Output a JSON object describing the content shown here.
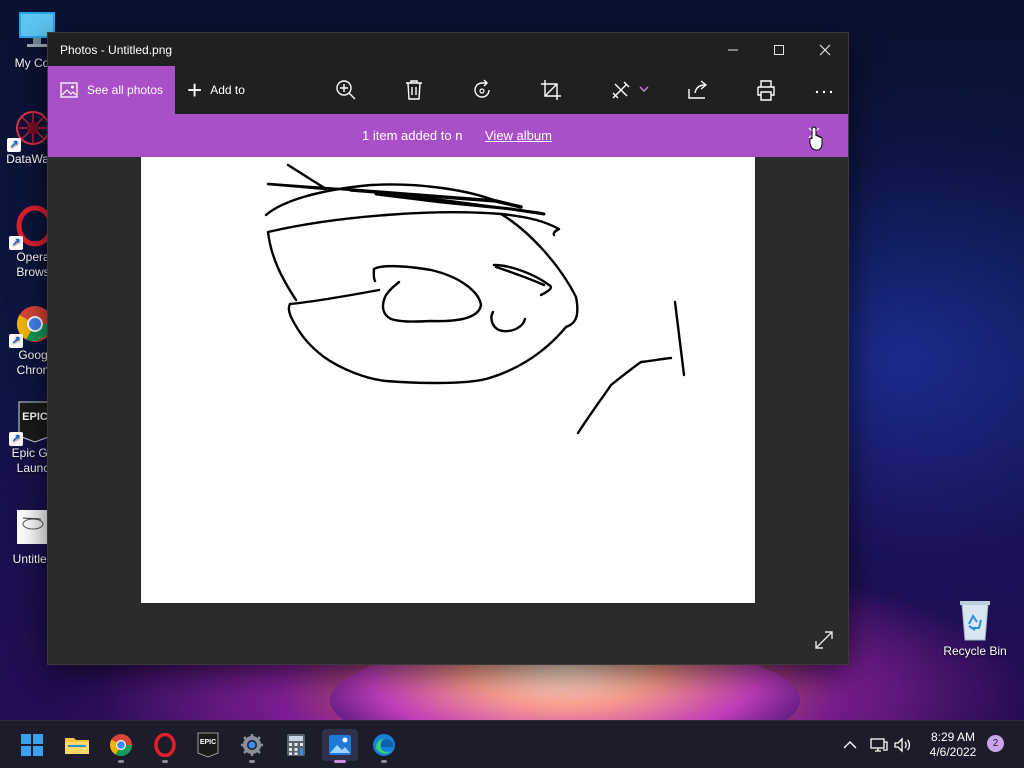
{
  "desktop": {
    "icons": [
      {
        "label": "My Com",
        "icon": "computer-icon"
      },
      {
        "label": "DataWag",
        "icon": "datawagon-icon"
      },
      {
        "label": "Opera\nBrows",
        "icon": "opera-icon"
      },
      {
        "label": "Goog\nChron",
        "icon": "chrome-icon"
      },
      {
        "label": "Epic Ga\nLaunc",
        "icon": "epic-games-icon",
        "badge_text": "EPIC"
      },
      {
        "label": "Untitled",
        "icon": "image-file-icon"
      }
    ],
    "recycle_bin": {
      "label": "Recycle Bin",
      "icon": "recycle-bin-icon"
    }
  },
  "window": {
    "title": "Photos - Untitled.png",
    "controls": {
      "minimize": "minimize-icon",
      "maximize": "maximize-icon",
      "close": "close-icon"
    },
    "toolbar": {
      "see_all_label": "See all photos",
      "add_to_label": "Add to",
      "tools": [
        "zoom-in-icon",
        "delete-icon",
        "rotate-icon",
        "crop-icon",
        "edit-draw-icon",
        "share-icon",
        "print-icon",
        "more-icon"
      ]
    },
    "notification": {
      "message": "1 item added to n",
      "link": "View album"
    }
  },
  "taskbar": {
    "apps": [
      "start-icon",
      "file-explorer-icon",
      "chrome-icon",
      "opera-icon",
      "epic-games-icon",
      "settings-icon",
      "calculator-icon",
      "photos-icon",
      "edge-icon"
    ],
    "epic_text": "EPIC",
    "active_app": "photos-icon",
    "clock": {
      "time": "8:29 AM",
      "date": "4/6/2022"
    },
    "notification_count": "2"
  },
  "colors": {
    "accent": "#a94fc7",
    "titlebar": "#202020",
    "window_bg": "#2b2b2b"
  }
}
